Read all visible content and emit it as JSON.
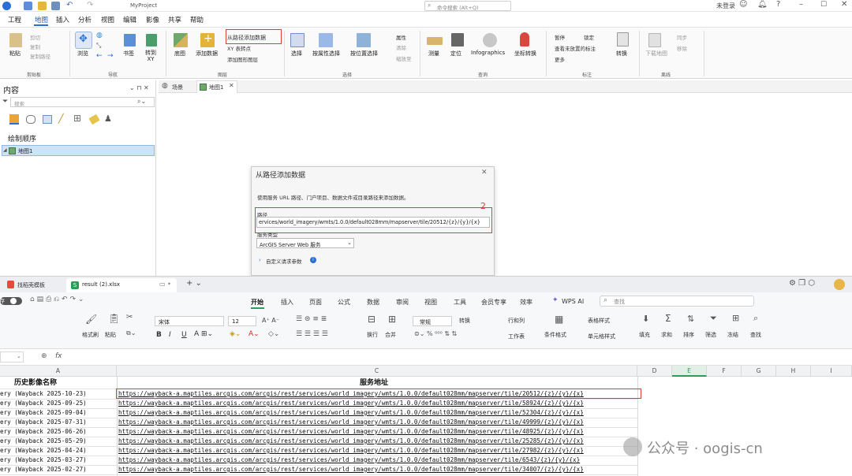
{
  "pro": {
    "title_bar": {
      "project": "MyProject",
      "search_placeholder": "命令搜索 (Alt+Q)",
      "user": "未登录"
    },
    "tabs": [
      "工程",
      "地图",
      "插入",
      "分析",
      "视图",
      "编辑",
      "影像",
      "共享",
      "帮助"
    ],
    "active_tab": "地图",
    "ribbon": {
      "clipboard": {
        "paste": "粘贴",
        "cut": "剪切",
        "copy": "复制",
        "copy_path": "复制路径",
        "group": "剪贴板"
      },
      "navigate": {
        "explore": "浏览",
        "bookmarks": "书签",
        "goto_xy": "转到\nXY",
        "group": "导航"
      },
      "layer": {
        "basemap": "底图",
        "add_data": "添加数据",
        "add_from_path": "从路径添加数据",
        "xy_to_point": "XY 表转点",
        "add_graphics_layer": "添加图形图层",
        "group": "图层"
      },
      "selection": {
        "select": "选择",
        "by_attribute": "按属性选择",
        "by_location": "按位置选择",
        "attributes": "属性",
        "clear": "清除",
        "zoom_to": "缩放至",
        "group": "选择"
      },
      "inquiry": {
        "measure": "测量",
        "locate": "定位",
        "infographics": "Infographics",
        "coord_convert": "坐标转换",
        "group": "查询"
      },
      "labeling": {
        "pause": "暂停",
        "lock": "锁定",
        "view_unplaced": "查看未放置的标注",
        "more": "更多",
        "convert": "转换",
        "group": "标注"
      },
      "offline": {
        "download_map": "下载地图",
        "sync": "同步",
        "remove": "移除",
        "group": "离线"
      }
    },
    "contents": {
      "title": "内容",
      "search_placeholder": "搜索",
      "draw_order": "绘制顺序",
      "layer": "地图1"
    },
    "view_tabs": [
      "场景",
      "地图1"
    ],
    "dialog": {
      "title": "从路径添加数据",
      "description": "使用服务 URL 路径、门户项目、数据文件或目录路径来添加数据。",
      "path_label": "路径",
      "path_value": "ervices/world_imagery/wmts/1.0.0/default028mm/mapserver/tile/20512/{z}/{y}/{x}",
      "service_type_label": "服务类型",
      "service_type_value": "ArcGIS Server Web 服务",
      "custom_params": "自定义请求参数",
      "annotation": "2"
    }
  },
  "wps": {
    "tabs": [
      {
        "label": "找稻壳模板"
      },
      {
        "label": "result (2).xlsx"
      }
    ],
    "menu": [
      "开始",
      "插入",
      "页面",
      "公式",
      "数据",
      "审阅",
      "视图",
      "工具",
      "会员专享",
      "效率",
      "WPS AI"
    ],
    "active_menu": "开始",
    "search_placeholder": "查找",
    "autosave_label": "存",
    "toolbar": {
      "format_painter": "格式刷",
      "paste": "粘贴",
      "cut": "",
      "font": "宋体",
      "size": "12",
      "wrap": "换行",
      "merge": "合并",
      "number_format": "常规",
      "convert": "转换",
      "rows_cols": "行和列",
      "worksheet": "工作表",
      "cond_format": "条件格式",
      "table_style": "表格样式",
      "cell_style": "单元格样式",
      "fill": "填充",
      "sum": "求和",
      "sort": "排序",
      "filter": "筛选",
      "freeze": "冻结",
      "find": "查找"
    },
    "formula_bar": {
      "fx": "fx",
      "value": ""
    },
    "columns": [
      "A",
      "C",
      "D",
      "E",
      "F",
      "G",
      "H",
      "I"
    ],
    "header_row": {
      "a": "历史影像名称",
      "c": "服务地址"
    },
    "rows": [
      {
        "a": "ery (Wayback 2025-10-23)",
        "c": "https://wayback-a.maptiles.arcgis.com/arcgis/rest/services/world_imagery/wmts/1.0.0/default028mm/mapserver/tile/20512/{z}/{y}/{x}"
      },
      {
        "a": "ery (Wayback 2025-09-25)",
        "c": "https://wayback-a.maptiles.arcgis.com/arcgis/rest/services/world_imagery/wmts/1.0.0/default028mm/mapserver/tile/58924/{z}/{y}/{x}"
      },
      {
        "a": "ery (Wayback 2025-09-04)",
        "c": "https://wayback-a.maptiles.arcgis.com/arcgis/rest/services/world_imagery/wmts/1.0.0/default028mm/mapserver/tile/52304/{z}/{y}/{x}"
      },
      {
        "a": "ery (Wayback 2025-07-31)",
        "c": "https://wayback-a.maptiles.arcgis.com/arcgis/rest/services/world_imagery/wmts/1.0.0/default028mm/mapserver/tile/49999/{z}/{y}/{x}"
      },
      {
        "a": "ery (Wayback 2025-06-26)",
        "c": "https://wayback-a.maptiles.arcgis.com/arcgis/rest/services/world_imagery/wmts/1.0.0/default028mm/mapserver/tile/48925/{z}/{y}/{x}"
      },
      {
        "a": "ery (Wayback 2025-05-29)",
        "c": "https://wayback-a.maptiles.arcgis.com/arcgis/rest/services/world_imagery/wmts/1.0.0/default028mm/mapserver/tile/25285/{z}/{y}/{x}"
      },
      {
        "a": "ery (Wayback 2025-04-24)",
        "c": "https://wayback-a.maptiles.arcgis.com/arcgis/rest/services/world_imagery/wmts/1.0.0/default028mm/mapserver/tile/27982/{z}/{y}/{x}"
      },
      {
        "a": "ery (Wayback 2025-03-27)",
        "c": "https://wayback-a.maptiles.arcgis.com/arcgis/rest/services/world_imagery/wmts/1.0.0/default028mm/mapserver/tile/6543/{z}/{y}/{x}"
      },
      {
        "a": "ery (Wayback 2025-02-27)",
        "c": "https://wayback-a.maptiles.arcgis.com/arcgis/rest/services/world_imagery/wmts/1.0.0/default028mm/mapserver/tile/34007/{z}/{y}/{x}"
      }
    ]
  },
  "watermark": {
    "text": "公众号 · oogis-cn"
  },
  "colors": {
    "accent_blue": "#2a6fd6",
    "highlight_red": "#e23b3b",
    "wps_green": "#2e9b57"
  }
}
